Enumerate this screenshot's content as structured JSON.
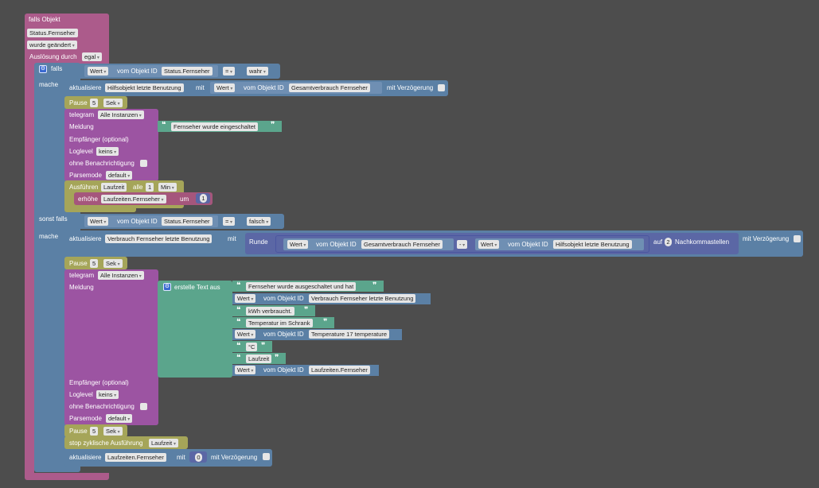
{
  "trigger": {
    "title": "falls Objekt",
    "object": "Status.Fernseher",
    "condition": "wurde geändert",
    "trigger_by_label": "Auslösung durch",
    "trigger_by": "egal"
  },
  "if_block": {
    "falls": "falls",
    "mache": "mache",
    "sonst_falls": "sonst falls",
    "mache2": "mache"
  },
  "cond1": {
    "wert": "Wert",
    "vom": "vom Objekt ID",
    "obj": "Status.Fernseher",
    "op": "=",
    "val": "wahr"
  },
  "update1": {
    "label": "aktualisiere",
    "target": "Hilfsobjekt letzte Benutzung",
    "mit": "mit",
    "wert": "Wert",
    "vom": "vom Objekt ID",
    "obj": "Gesamtverbrauch Fernseher",
    "delay": "mit Verzögerung"
  },
  "pause1": {
    "label": "Pause",
    "num": "5",
    "unit": "Sek"
  },
  "telegram1": {
    "label": "telegram",
    "instance": "Alle Instanzen",
    "meldung": "Meldung",
    "message": "Fernseher wurde eingeschaltet",
    "empf": "Empfänger (optional)",
    "loglevel": "Loglevel",
    "loglevel_val": "keins",
    "ohne": "ohne Benachrichtigung",
    "parsemode": "Parsemode",
    "parsemode_val": "default"
  },
  "interval": {
    "label": "Ausführen",
    "name": "Laufzeit",
    "alle": "alle",
    "num": "1",
    "unit": "Min"
  },
  "increment": {
    "label": "erhöhe",
    "var": "Laufzeiten.Fernseher",
    "um": "um",
    "num": "1"
  },
  "cond2": {
    "wert": "Wert",
    "vom": "vom Objekt ID",
    "obj": "Status.Fernseher",
    "op": "=",
    "val": "falsch"
  },
  "update2": {
    "label": "aktualisiere",
    "target": "Verbrauch Fernseher letzte Benutzung",
    "mit": "mit",
    "runde": "Runde",
    "wert_a": "Wert",
    "vom_a": "vom Objekt ID",
    "obj_a": "Gesamtverbrauch Fernseher",
    "op": "-",
    "wert_b": "Wert",
    "vom_b": "vom Objekt ID",
    "obj_b": "Hilfsobjekt letzte Benutzung",
    "auf": "auf",
    "decimals": "2",
    "nachkomma": "Nachkommastellen",
    "delay": "mit Verzögerung"
  },
  "pause2": {
    "label": "Pause",
    "num": "5",
    "unit": "Sek"
  },
  "telegram2": {
    "label": "telegram",
    "instance": "Alle Instanzen",
    "meldung": "Meldung",
    "create_text": "erstelle Text aus",
    "parts": [
      "Fernseher wurde ausgeschaltet und hat",
      "Verbrauch Fernseher letzte Benutzung",
      "kWh verbraucht.",
      "Temperatur im Schrank",
      "Temperature 17 temperature",
      "°C",
      "Laufzeit",
      "Laufzeiten.Fernseher"
    ],
    "wert": "Wert",
    "vom": "vom Objekt ID",
    "empf": "Empfänger (optional)",
    "loglevel": "Loglevel",
    "loglevel_val": "keins",
    "ohne": "ohne Benachrichtigung",
    "parsemode": "Parsemode",
    "parsemode_val": "default"
  },
  "pause3": {
    "label": "Pause",
    "num": "5",
    "unit": "Sek"
  },
  "stop": {
    "label": "stop zyklische Ausführung",
    "name": "Laufzeit"
  },
  "update3": {
    "label": "aktualisiere",
    "target": "Laufzeiten.Fernseher",
    "mit": "mit",
    "num": "0",
    "delay": "mit Verzögerung"
  },
  "colors": {
    "background": "#4d4d4d",
    "trigger": "#ac5b8b",
    "logic": "#5b80a5",
    "telegram": "#9c54a2",
    "timer": "#a5a559",
    "text": "#5ba58c",
    "math": "#5b67a5"
  },
  "icons": {
    "gear": "gear-icon",
    "quote": "quote-icon",
    "dropdown": "chevron-down-icon"
  }
}
